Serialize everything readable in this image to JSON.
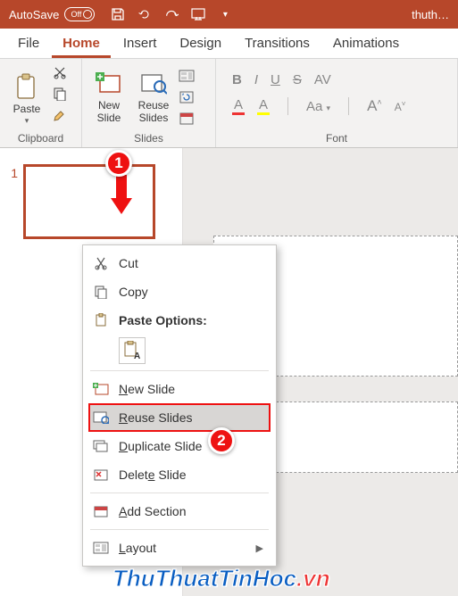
{
  "titlebar": {
    "autosave_label": "AutoSave",
    "autosave_state": "Off",
    "doc_name": "thuth…"
  },
  "tabs": {
    "file": "File",
    "home": "Home",
    "insert": "Insert",
    "design": "Design",
    "transitions": "Transitions",
    "animations": "Animations"
  },
  "ribbon": {
    "clipboard": {
      "paste": "Paste",
      "label": "Clipboard"
    },
    "slides": {
      "new_slide": "New\nSlide",
      "reuse": "Reuse\nSlides",
      "label": "Slides"
    },
    "font": {
      "bold": "B",
      "italic": "I",
      "underline": "U",
      "strike": "S",
      "font_size_label": "Aa",
      "grow": "A",
      "shrink": "A",
      "label": "Font"
    }
  },
  "thumbs": {
    "slide1_index": "1"
  },
  "context_menu": {
    "cut": "Cut",
    "copy": "Copy",
    "paste_options": "Paste Options:",
    "paste_a": "A",
    "new_slide": "New Slide",
    "reuse_slides": "Reuse Slides",
    "duplicate_slide": "Duplicate Slide",
    "delete_slide": "Delete Slide",
    "add_section": "Add Section",
    "layout": "Layout"
  },
  "callouts": {
    "c1": "1",
    "c2": "2"
  },
  "watermark": {
    "main": "ThuThuatTinHoc",
    "tld": ".vn"
  }
}
